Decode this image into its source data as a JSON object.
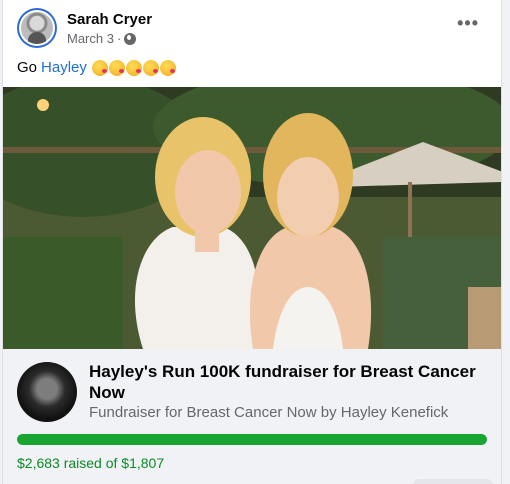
{
  "post": {
    "author": "Sarah Cryer",
    "date": "March 3",
    "separator": "·",
    "audience_icon": "globe-icon",
    "text_prefix": "Go",
    "mention": "Hayley",
    "emoji_count": 5,
    "emoji_icon": "kissing-face-emoji",
    "more_label": "•••"
  },
  "fundraiser": {
    "title": "Hayley's Run 100K fundraiser for Breast Cancer Now",
    "subtitle": "Fundraiser for Breast Cancer Now by Hayley Kenefick",
    "raised_text": "$2,683 raised of $1,807",
    "progress_fraction": 1.0
  },
  "colors": {
    "link": "#216fdb",
    "progress": "#19a532",
    "raised_text": "#0d8a26",
    "panel": "#f0f2f5"
  }
}
